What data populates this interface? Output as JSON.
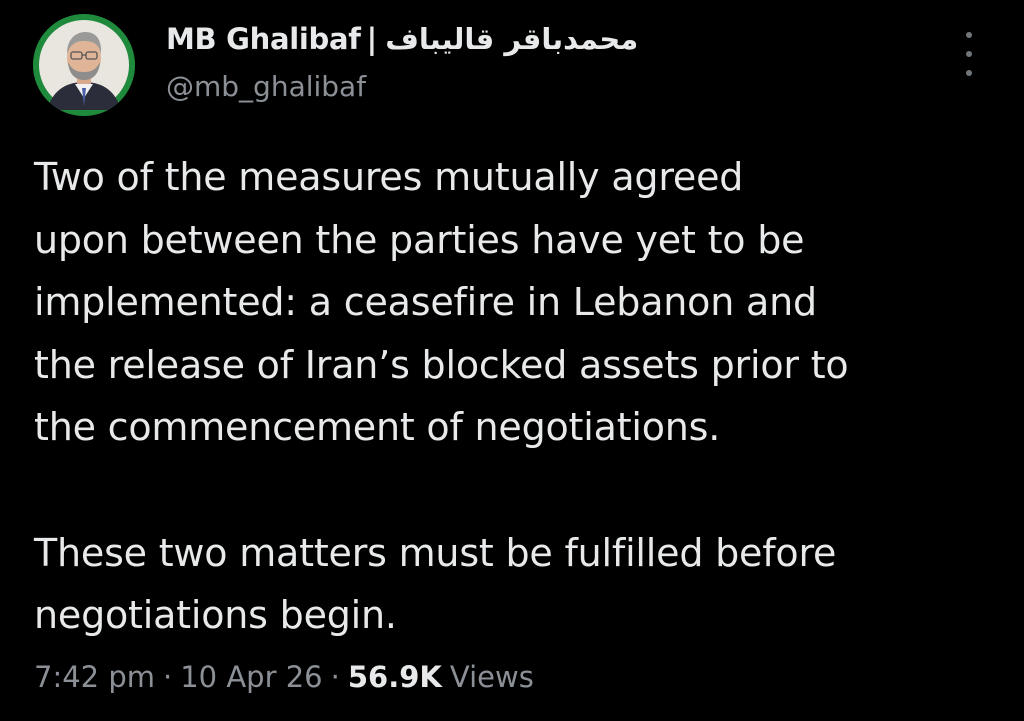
{
  "author": {
    "name_latin": "MB Ghalibaf",
    "separator": "|",
    "name_farsi": "محمدباقر قالیباف",
    "handle": "@mb_ghalibaf",
    "avatar_ring_color": "#1f8a3c"
  },
  "menu": {
    "icon": "more-vertical-icon"
  },
  "tweet": {
    "paragraph_1": "Two of the measures mutually agreed\nupon between the parties have yet to be\nimplemented: a ceasefire in Lebanon and\nthe release of Iran’s blocked assets prior to\nthe commencement of negotiations.",
    "paragraph_2": "These two matters must be fulfilled before\nnegotiations begin."
  },
  "meta": {
    "time": "7:42 pm",
    "dot": "·",
    "date": "10 Apr 26",
    "views_count": "56.9K",
    "views_label": "Views"
  }
}
